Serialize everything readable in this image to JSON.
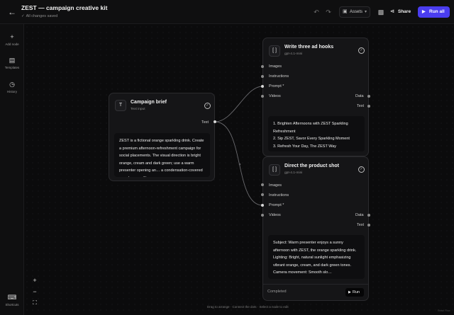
{
  "header": {
    "title": "ZEST — campaign creative kit",
    "saved_status": "All changes saved",
    "assets_label": "Assets",
    "share_label": "Share",
    "run_all_label": "Run all"
  },
  "rail": [
    {
      "icon": "plus-icon",
      "label": "Add node"
    },
    {
      "icon": "templates-icon",
      "label": "Templates"
    },
    {
      "icon": "history-icon",
      "label": "History"
    },
    {
      "icon": "keyboard-icon",
      "label": "Shortcuts"
    }
  ],
  "nodes": {
    "brief": {
      "title": "Campaign brief",
      "subtitle": "Text input",
      "output_port": "Text",
      "content": "ZEST is a fictional orange sparkling drink. Create a premium afternoon-refreshment campaign for social placements. The visual direction is bright orange, cream and dark green; use a warm presenter opening an… a condensation-covered can close-up. No"
    },
    "hooks": {
      "title": "Write three ad hooks",
      "subtitle": "gpt-4.1-mini",
      "inputs": [
        "Images",
        "Instructions",
        "Prompt",
        "Videos"
      ],
      "required_mark": "*",
      "outputs": [
        "Data",
        "Text"
      ],
      "content": "1. Brighten Afternoons with ZEST Sparkling Refreshment\n2. Sip ZEST, Savor Every Sparkling Moment\n3. Refresh Your Day, The ZEST Way"
    },
    "shot": {
      "title": "Direct the product shot",
      "subtitle": "gpt-4.1-mini",
      "inputs": [
        "Images",
        "Instructions",
        "Prompt",
        "Videos"
      ],
      "required_mark": "*",
      "outputs": [
        "Data",
        "Text"
      ],
      "content": "Subject: Warm presenter enjoys a sunny afternoon with ZEST, the orange sparkling drink. Lighting: Bright, natural sunlight emphasizing vibrant orange, cream, and dark green tones. Camera movement: Smooth slo…",
      "status": "Completed",
      "run_label": "Run"
    }
  },
  "canvas_hint": "Drag to arrange · Connect the dots · Select a node to edit",
  "watermark": "React Flow",
  "colors": {
    "accent": "#4a3df0",
    "background": "#0b0b0c",
    "node": "#151517"
  }
}
